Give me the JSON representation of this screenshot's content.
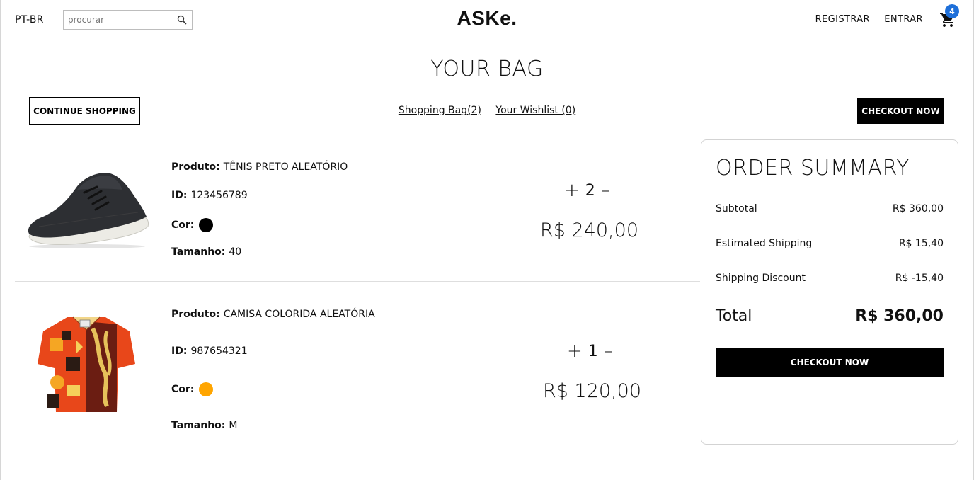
{
  "navbar": {
    "language": "PT-BR",
    "search_placeholder": "procurar",
    "logo": "ASKe.",
    "register_label": "REGISTRAR",
    "login_label": "ENTRAR",
    "cart_count": "4"
  },
  "page_title": "YOUR BAG",
  "actions": {
    "continue_label": "CONTINUE SHOPPING",
    "tab_bag": "Shopping Bag(2)",
    "tab_wishlist": "Your Wishlist (0)",
    "checkout_label": "CHECKOUT NOW"
  },
  "field_labels": {
    "product": "Produto:",
    "id": "ID:",
    "color": "Cor:",
    "size": "Tamanho:"
  },
  "products": [
    {
      "name": "TÊNIS PRETO ALEATÓRIO",
      "id": "123456789",
      "color": "#000000",
      "size": "40",
      "quantity": "2",
      "price": "R$ 240,00"
    },
    {
      "name": "CAMISA COLORIDA ALEATÓRIA",
      "id": "987654321",
      "color": "#ffa500",
      "size": "M",
      "quantity": "1",
      "price": "R$ 120,00"
    }
  ],
  "summary": {
    "title": "ORDER SUMMARY",
    "subtotal_label": "Subtotal",
    "subtotal_value": "R$ 360,00",
    "shipping_label": "Estimated Shipping",
    "shipping_value": "R$ 15,40",
    "discount_label": "Shipping Discount",
    "discount_value": "R$ -15,40",
    "total_label": "Total",
    "total_value": "R$ 360,00",
    "checkout_label": "CHECKOUT NOW"
  },
  "colors": {
    "accent": "#000000",
    "badge": "#1e6fd9"
  }
}
